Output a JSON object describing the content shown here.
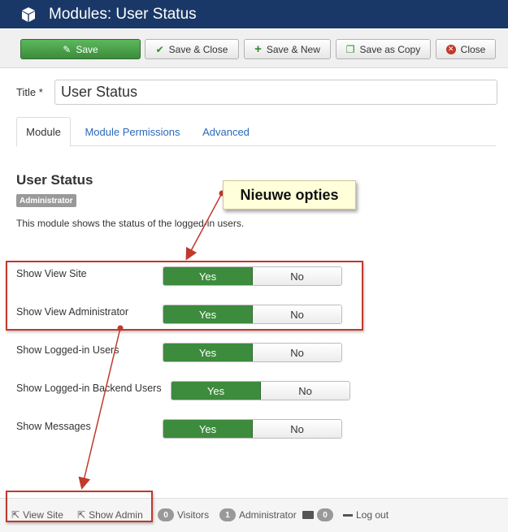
{
  "header": {
    "title": "Modules: User Status",
    "icon": "cube-icon"
  },
  "toolbar": {
    "save": "Save",
    "save_close": "Save & Close",
    "save_new": "Save & New",
    "save_copy": "Save as Copy",
    "close": "Close"
  },
  "form": {
    "title_label": "Title *",
    "title_value": "User Status"
  },
  "tabs": [
    {
      "label": "Module",
      "active": true
    },
    {
      "label": "Module Permissions",
      "active": false
    },
    {
      "label": "Advanced",
      "active": false
    }
  ],
  "module": {
    "title": "User Status",
    "badge": "Administrator",
    "description": "This module shows the status of the logged-in users."
  },
  "options": [
    {
      "label": "Show View Site",
      "value": "Yes",
      "yes": "Yes",
      "no": "No"
    },
    {
      "label": "Show View Administrator",
      "value": "Yes",
      "yes": "Yes",
      "no": "No"
    },
    {
      "label": "Show Logged-in Users",
      "value": "Yes",
      "yes": "Yes",
      "no": "No"
    },
    {
      "label": "Show Logged-in Backend Users",
      "value": "Yes",
      "yes": "Yes",
      "no": "No"
    },
    {
      "label": "Show Messages",
      "value": "Yes",
      "yes": "Yes",
      "no": "No"
    }
  ],
  "callout": {
    "text": "Nieuwe opties"
  },
  "statusbar": {
    "view_site": "View Site",
    "show_admin": "Show Admin",
    "visitors_count": "0",
    "visitors_label": "Visitors",
    "admin_count": "1",
    "admin_label": "Administrator",
    "messages_count": "0",
    "logout": "Log out"
  },
  "colors": {
    "header": "#1a3867",
    "primary": "#3d8b3d",
    "annotation": "#c0392b",
    "callout_bg": "#ffffd9"
  }
}
